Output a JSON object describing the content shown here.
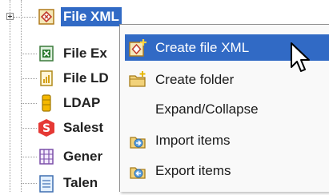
{
  "tree": {
    "nodes": [
      {
        "label": "File XML",
        "icon": "xml-file-icon"
      },
      {
        "label": "File Ex",
        "icon": "excel-file-icon"
      },
      {
        "label": "File LD",
        "icon": "ldif-file-icon"
      },
      {
        "label": "LDAP",
        "icon": "ldap-icon"
      },
      {
        "label": "Salest",
        "icon": "salesforce-icon"
      },
      {
        "label": "Gener",
        "icon": "generic-schema-icon"
      },
      {
        "label": "Talen",
        "icon": "talend-doc-icon"
      }
    ]
  },
  "context_menu": {
    "items": [
      {
        "label": "Create file XML",
        "icon": "create-xml-icon",
        "highlighted": true
      },
      {
        "label": "Create folder",
        "icon": "folder-icon"
      },
      {
        "label": "Expand/Collapse",
        "icon": ""
      },
      {
        "label": "Import items",
        "icon": "import-icon"
      },
      {
        "label": "Export items",
        "icon": "export-icon"
      }
    ]
  },
  "colors": {
    "selection": "#316ac5",
    "menu_background": "#f9f9f9",
    "tree_lines": "#9a9a9a"
  }
}
